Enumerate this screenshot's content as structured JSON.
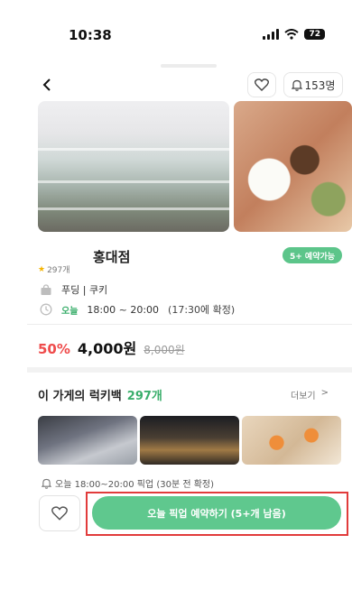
{
  "status_bar": {
    "time": "10:38",
    "battery": "72"
  },
  "header": {
    "notify_count": "153명"
  },
  "store": {
    "name": "홍대점",
    "badge": "5+ 예약가능",
    "rating": "297개",
    "category": "푸딩 | 쿠키",
    "today_label": "오늘",
    "hours": "18:00 ~ 20:00",
    "confirm_note": "(17:30에 확정)"
  },
  "price": {
    "discount": "50%",
    "current": "4,000원",
    "original": "8,000원"
  },
  "lucky_bag": {
    "title": "이 가게의 럭키백",
    "count": "297개",
    "more": "더보기",
    "more_chevron": ">"
  },
  "pickup_note": "오늘 18:00~20:00 픽업 (30분 전 확정)",
  "cta": {
    "reserve_label": "오늘 픽업 예약하기 (5+개 남음)"
  },
  "icons": {
    "back": "chevron-left-icon",
    "heart": "heart-icon",
    "bell": "bell-icon",
    "bag": "bag-icon",
    "clock": "clock-icon",
    "star": "star-icon"
  },
  "colors": {
    "accent_green": "#5fc88e",
    "discount_red": "#ef4c4c",
    "highlight_red": "#e13b3b"
  }
}
